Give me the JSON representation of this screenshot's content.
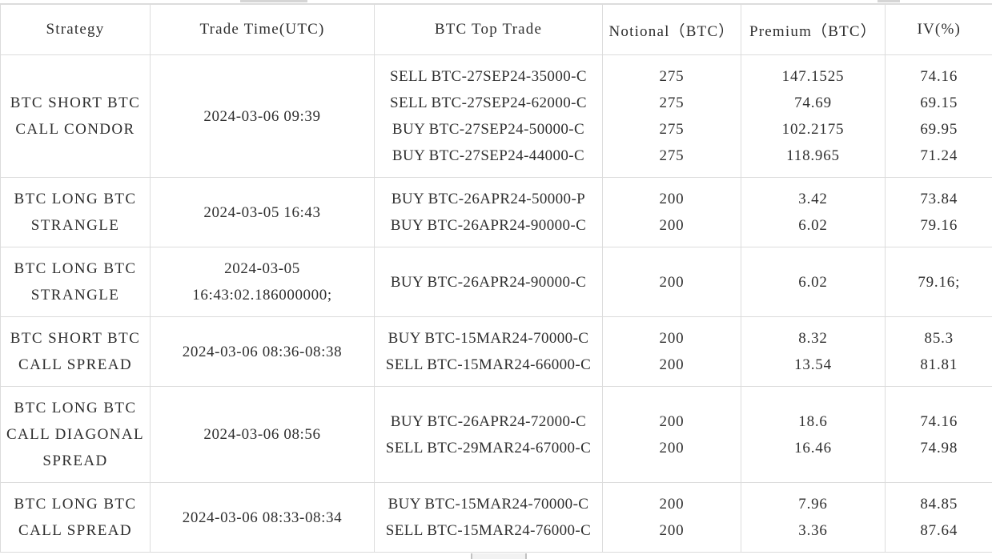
{
  "table": {
    "columns": [
      "Strategy",
      "Trade Time(UTC)",
      "BTC Top Trade",
      "Notional（BTC）",
      "Premium（BTC）",
      "IV(%)"
    ],
    "rows": [
      {
        "strategy": [
          "BTC SHORT BTC",
          "CALL CONDOR"
        ],
        "time": [
          "2024-03-06 09:39"
        ],
        "trades": [
          "SELL BTC-27SEP24-35000-C",
          "SELL BTC-27SEP24-62000-C",
          "BUY BTC-27SEP24-50000-C",
          "BUY BTC-27SEP24-44000-C"
        ],
        "notional": [
          "275",
          "275",
          "275",
          "275"
        ],
        "premium": [
          "147.1525",
          "74.69",
          "102.2175",
          "118.965"
        ],
        "iv": [
          "74.16",
          "69.15",
          "69.95",
          "71.24"
        ]
      },
      {
        "strategy": [
          "BTC LONG BTC",
          "STRANGLE"
        ],
        "time": [
          "2024-03-05 16:43"
        ],
        "trades": [
          "BUY BTC-26APR24-50000-P",
          "BUY BTC-26APR24-90000-C"
        ],
        "notional": [
          "200",
          "200"
        ],
        "premium": [
          "3.42",
          "6.02"
        ],
        "iv": [
          "73.84",
          "79.16"
        ]
      },
      {
        "strategy": [
          "BTC LONG BTC",
          "STRANGLE"
        ],
        "time": [
          "2024-03-05",
          "16:43:02.186000000;"
        ],
        "trades": [
          "BUY BTC-26APR24-90000-C"
        ],
        "notional": [
          "200"
        ],
        "premium": [
          "6.02"
        ],
        "iv": [
          "79.16;"
        ]
      },
      {
        "strategy": [
          "BTC SHORT BTC",
          "CALL SPREAD"
        ],
        "time": [
          "2024-03-06 08:36-08:38"
        ],
        "trades": [
          "BUY BTC-15MAR24-70000-C",
          "SELL BTC-15MAR24-66000-C"
        ],
        "notional": [
          "200",
          "200"
        ],
        "premium": [
          "8.32",
          "13.54"
        ],
        "iv": [
          "85.3",
          "81.81"
        ]
      },
      {
        "strategy": [
          "BTC LONG BTC",
          "CALL DIAGONAL",
          "SPREAD"
        ],
        "time": [
          "2024-03-06 08:56"
        ],
        "trades": [
          "BUY BTC-26APR24-72000-C",
          "SELL BTC-29MAR24-67000-C"
        ],
        "notional": [
          "200",
          "200"
        ],
        "premium": [
          "18.6",
          "16.46"
        ],
        "iv": [
          "74.16",
          "74.98"
        ]
      },
      {
        "strategy": [
          "BTC LONG BTC",
          "CALL SPREAD"
        ],
        "time": [
          "2024-03-06 08:33-08:34"
        ],
        "trades": [
          "BUY BTC-15MAR24-70000-C",
          "SELL BTC-15MAR24-76000-C"
        ],
        "notional": [
          "200",
          "200"
        ],
        "premium": [
          "7.96",
          "3.36"
        ],
        "iv": [
          "84.85",
          "87.64"
        ]
      }
    ]
  },
  "colors": {
    "border": "#dcdcdc",
    "text": "#2f2f2f",
    "background": "#ffffff"
  }
}
